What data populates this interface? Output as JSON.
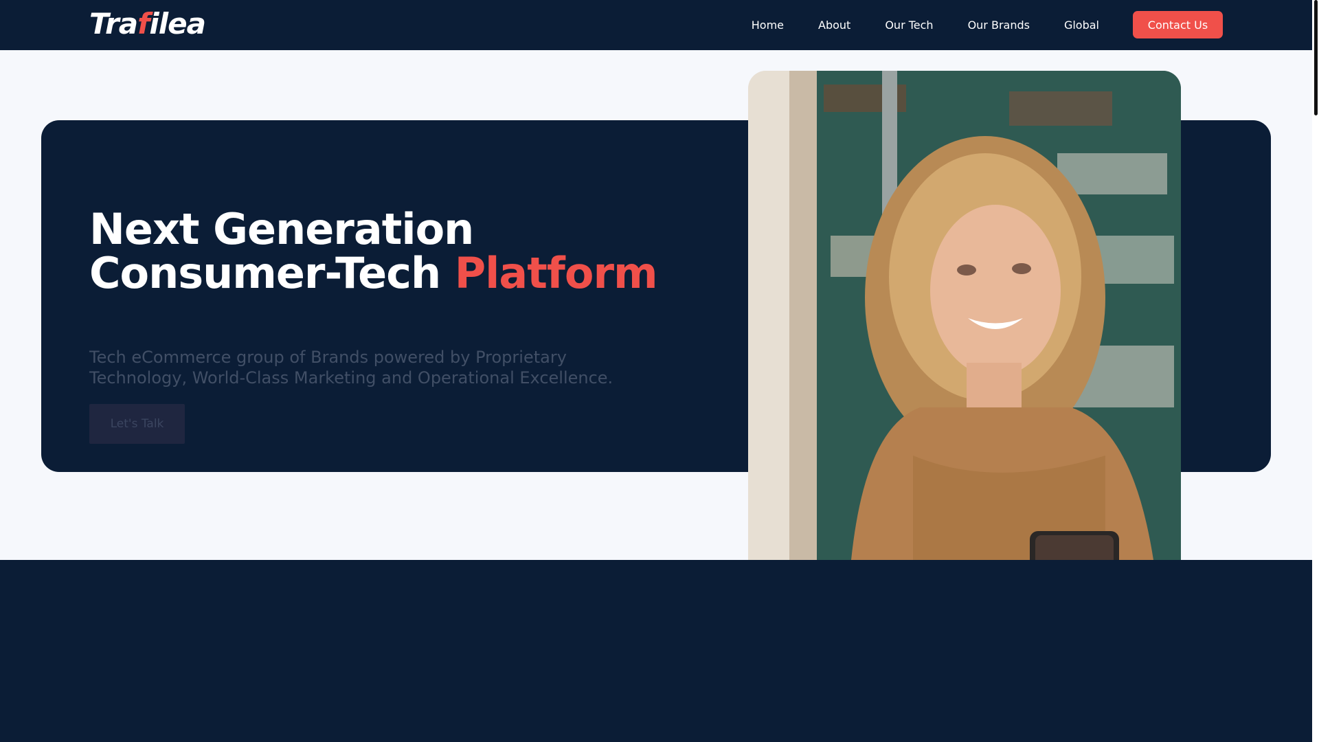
{
  "header": {
    "logo_prefix": "Tra",
    "logo_mark": "f",
    "logo_suffix": "ilea",
    "nav": [
      "Home",
      "About",
      "Our Tech",
      "Our Brands",
      "Global"
    ],
    "contact_label": "Contact Us"
  },
  "hero": {
    "title_line1": "Next Generation",
    "title_line2_plain": "Consumer-Tech ",
    "title_line2_accent": "Platform",
    "subtitle": "Tech eCommerce group of Brands powered by Proprietary Technology, World-Class Marketing and Operational Excellence.",
    "cta_label": "Let's Talk",
    "photo_alt": "woman-with-phone-photo"
  },
  "colors": {
    "navy": "#0b1d36",
    "accent": "#f0504a",
    "light_bg": "#f6f8fc"
  },
  "icons": {
    "logo": "trafilea-logo"
  }
}
